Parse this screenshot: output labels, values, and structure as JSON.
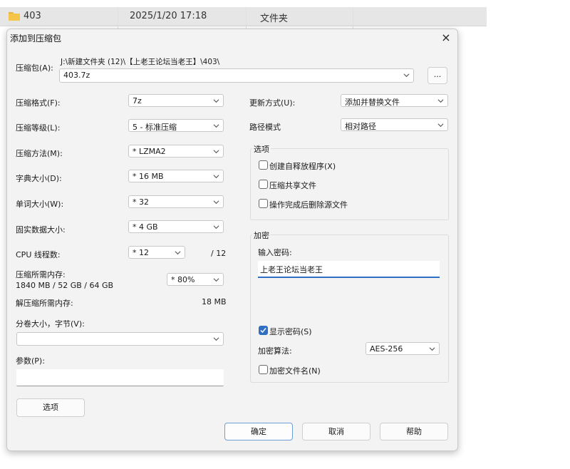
{
  "background_row": {
    "name": "403",
    "date": "2025/1/20 17:18",
    "type": "文件夹"
  },
  "dialog": {
    "title": "添加到压缩包",
    "close_icon": "×",
    "archive_label": "压缩包(A):",
    "archive_path": "J:\\新建文件夹 (12)\\【上老王论坛当老王】\\403\\",
    "archive_name": "403.7z",
    "browse_label": "...",
    "format_label": "压缩格式(F):",
    "format_value": "7z",
    "level_label": "压缩等级(L):",
    "level_value": "5 - 标准压缩",
    "method_label": "压缩方法(M):",
    "method_value": "*  LZMA2",
    "dict_label": "字典大小(D):",
    "dict_value": "*  16 MB",
    "word_label": "单词大小(W):",
    "word_value": "*  32",
    "solid_label": "固实数据大小:",
    "solid_value": "*  4 GB",
    "cpu_label": "CPU 线程数:",
    "cpu_value": "*  12",
    "cpu_total": "/ 12",
    "mem_label": "压缩所需内存:",
    "mem_value": "1840 MB / 52 GB / 64 GB",
    "mem_percent": "*  80%",
    "decomp_label": "解压缩所需内存:",
    "decomp_value": "18 MB",
    "volume_label": "分卷大小，字节(V):",
    "volume_value": "",
    "params_label": "参数(P):",
    "params_value": "",
    "options_button": "选项",
    "update_label": "更新方式(U):",
    "update_value": "添加并替换文件",
    "path_label": "路径模式",
    "path_value": "相对路径",
    "options_group": {
      "title": "选项",
      "items": [
        "创建自释放程序(X)",
        "压缩共享文件",
        "操作完成后删除源文件"
      ]
    },
    "encrypt_group": {
      "title": "加密",
      "password_label": "输入密码:",
      "password_value": "上老王论坛当老王",
      "show_password": "显示密码(S)",
      "show_password_checked": true,
      "method_label": "加密算法:",
      "method_value": "AES-256",
      "encrypt_names": "加密文件名(N)",
      "encrypt_names_checked": false
    },
    "ok_button": "确定",
    "cancel_button": "取消",
    "help_button": "帮助"
  },
  "colors": {
    "accent": "#2f6fc4",
    "dialog_bg": "#f3f3f3",
    "folder": "#f5c54a"
  },
  "icons": [
    "folder-icon",
    "close-icon",
    "chevron-down-icon",
    "checkbox-icon"
  ]
}
